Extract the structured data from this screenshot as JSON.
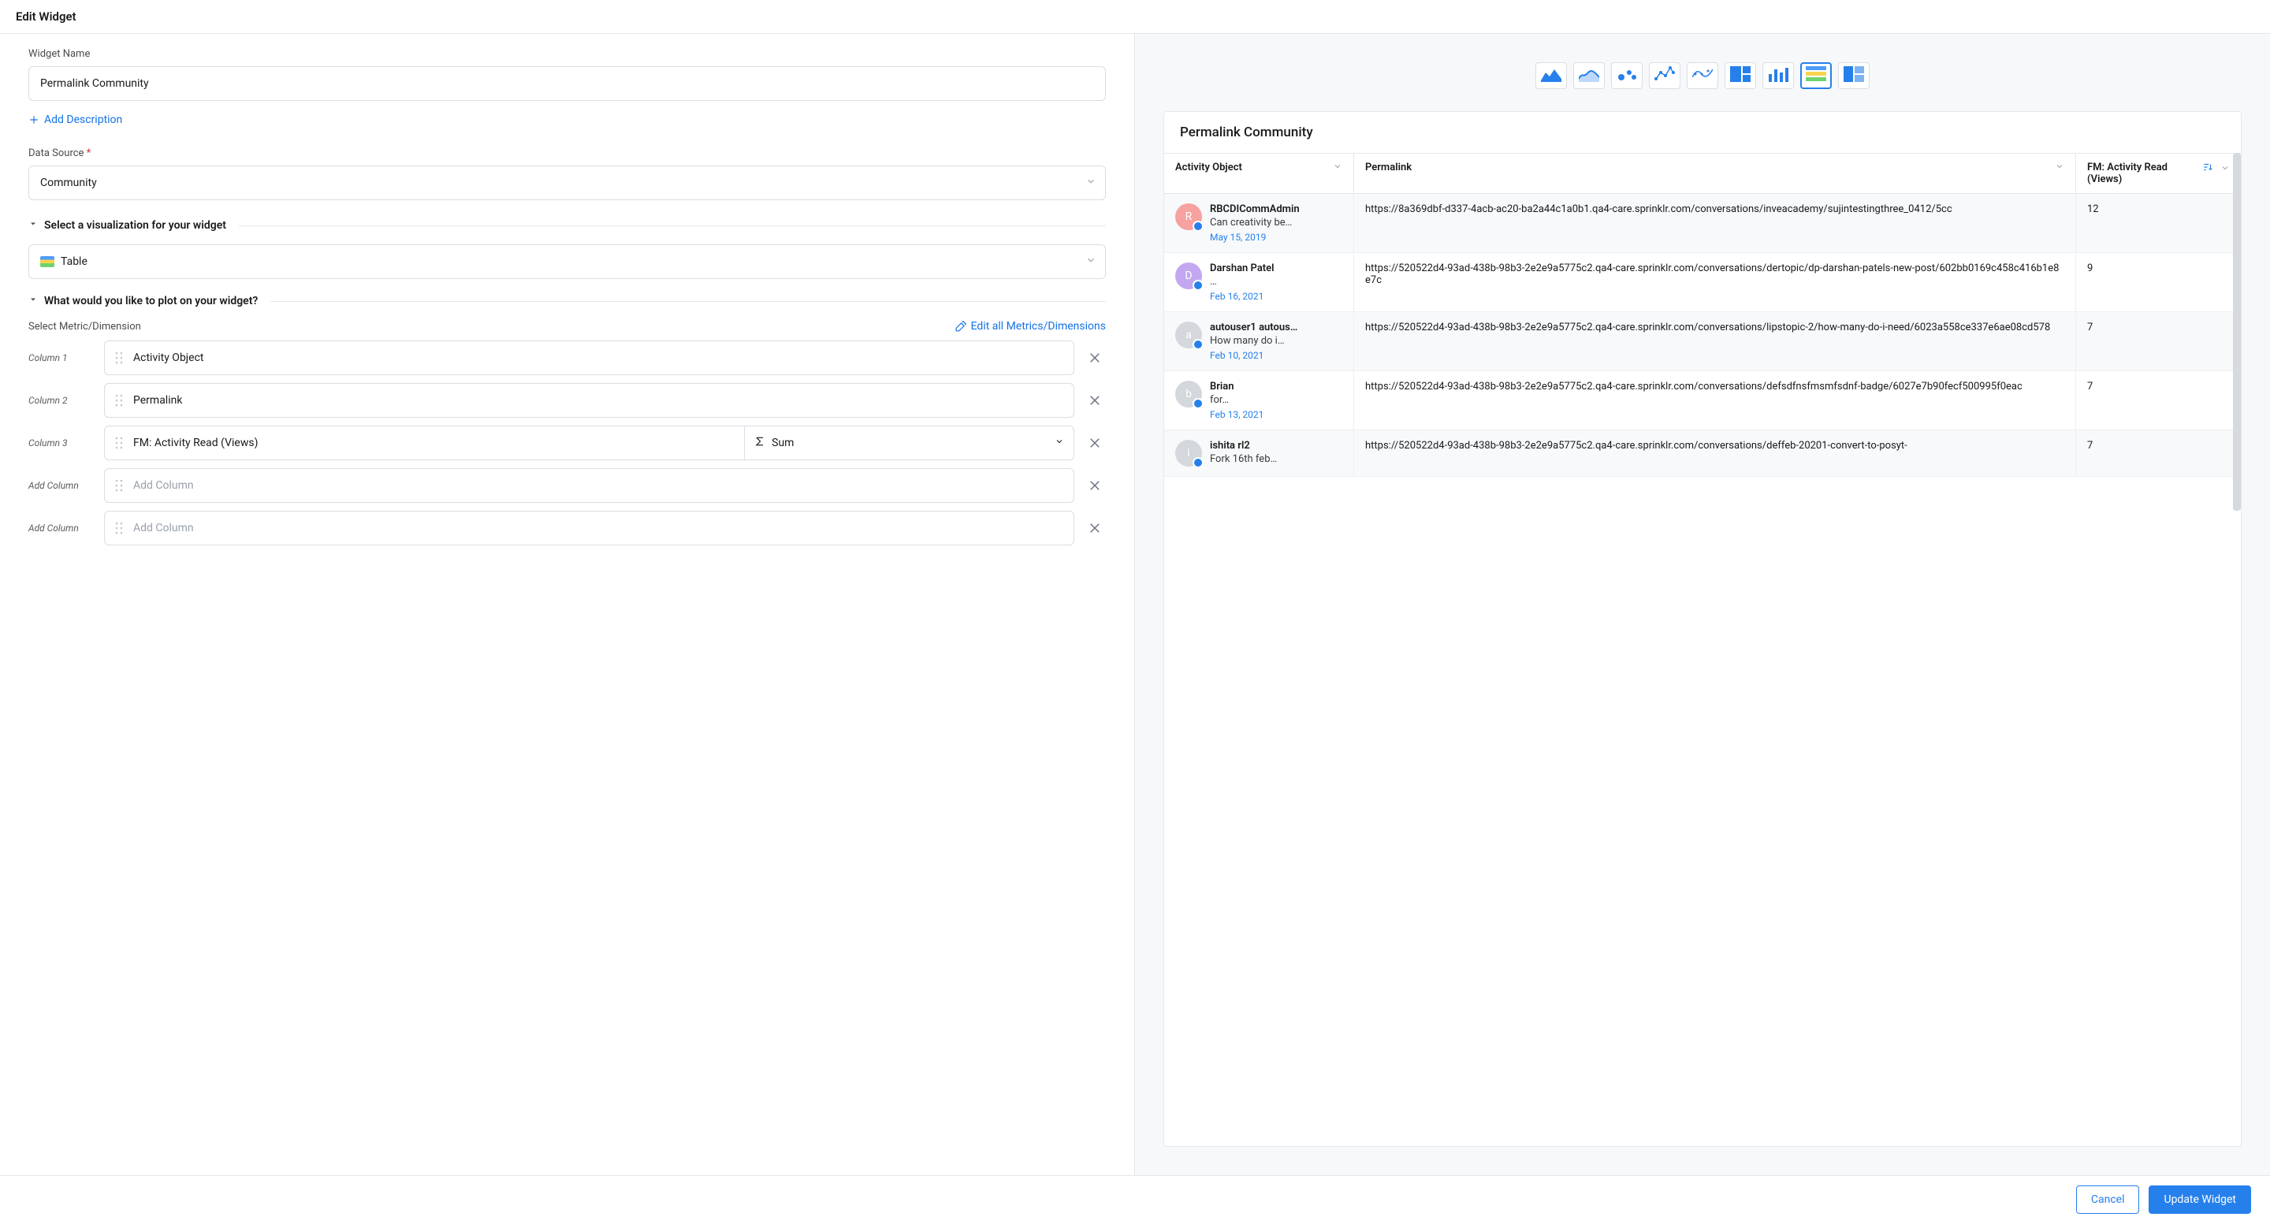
{
  "header": {
    "title": "Edit Widget"
  },
  "form": {
    "widget_name_label": "Widget Name",
    "widget_name_value": "Permalink Community",
    "add_description": "Add Description",
    "data_source_label": "Data Source",
    "data_source_required": "*",
    "data_source_value": "Community"
  },
  "section_viz": {
    "title": "Select a visualization for your widget",
    "value": "Table"
  },
  "section_plot": {
    "title": "What would you like to plot on your widget?",
    "metric_label": "Select Metric/Dimension",
    "edit_all": "Edit all Metrics/Dimensions",
    "columns": [
      {
        "label": "Column 1",
        "value": "Activity Object",
        "agg": null
      },
      {
        "label": "Column 2",
        "value": "Permalink",
        "agg": null
      },
      {
        "label": "Column 3",
        "value": "FM: Activity Read (Views)",
        "agg": "Sum"
      }
    ],
    "add_column_label": "Add Column",
    "add_column_placeholder": "Add Column"
  },
  "viz_types": [
    "area",
    "line",
    "bubble",
    "connected",
    "spline",
    "treemap",
    "bar",
    "table",
    "stacked"
  ],
  "preview": {
    "title": "Permalink Community",
    "headers": {
      "col1": "Activity Object",
      "col2": "Permalink",
      "col3": "FM: Activity Read (Views)"
    },
    "sort_on": "col3"
  },
  "chart_data": {
    "type": "table",
    "columns": [
      "Activity Object",
      "Permalink",
      "FM: Activity Read (Views)"
    ],
    "rows": [
      {
        "avatar_letter": "R",
        "avatar_color": "#f7a1a1",
        "user": "RBCDICommAdmin",
        "subtitle": "Can creativity be…",
        "date": "May 15, 2019",
        "permalink": "https://8a369dbf-d337-4acb-ac20-ba2a44c1a0b1.qa4-care.sprinklr.com/conversations/inveacademy/sujintestingthree_0412/5cc",
        "views": 12
      },
      {
        "avatar_letter": "D",
        "avatar_color": "#c3a7f0",
        "user": "Darshan Patel",
        "subtitle": "…",
        "date": "Feb 16, 2021",
        "permalink": "https://520522d4-93ad-438b-98b3-2e2e9a5775c2.qa4-care.sprinklr.com/conversations/dertopic/dp-darshan-patels-new-post/602bb0169c458c416b1e8e7c",
        "views": 9
      },
      {
        "avatar_letter": "a",
        "avatar_color": "#d4d7db",
        "user": "autouser1 autous…",
        "subtitle": "How many do i…",
        "date": "Feb 10, 2021",
        "permalink": "https://520522d4-93ad-438b-98b3-2e2e9a5775c2.qa4-care.sprinklr.com/conversations/lipstopic-2/how-many-do-i-need/6023a558ce337e6ae08cd578",
        "views": 7
      },
      {
        "avatar_letter": "b",
        "avatar_color": "#d4d7db",
        "user": "Brian",
        "subtitle": "for…",
        "date": "Feb 13, 2021",
        "permalink": "https://520522d4-93ad-438b-98b3-2e2e9a5775c2.qa4-care.sprinklr.com/conversations/defsdfnsfmsmfsdnf-badge/6027e7b90fecf500995f0eac",
        "views": 7
      },
      {
        "avatar_letter": "i",
        "avatar_color": "#d4d7db",
        "user": "ishita rl2",
        "subtitle": "Fork 16th feb…",
        "date": "",
        "permalink": "https://520522d4-93ad-438b-98b3-2e2e9a5775c2.qa4-care.sprinklr.com/conversations/deffeb-20201-convert-to-posyt-",
        "views": 7
      }
    ]
  },
  "footer": {
    "cancel": "Cancel",
    "update": "Update Widget"
  }
}
